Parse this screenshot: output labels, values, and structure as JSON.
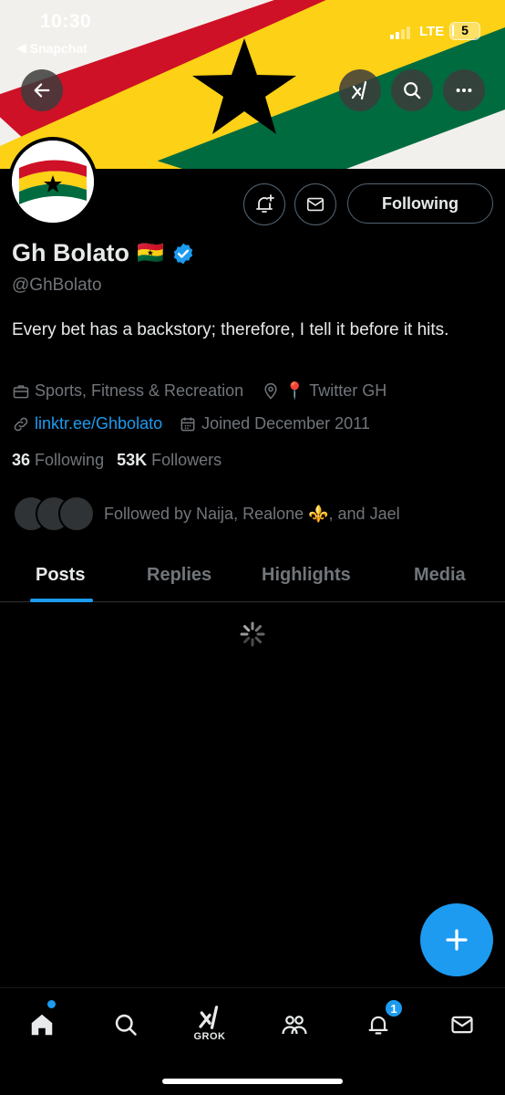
{
  "status_bar": {
    "time": "10:30",
    "back_app": "Snapchat",
    "network": "LTE",
    "battery": "5",
    "battery_level": 0.05
  },
  "profile": {
    "name": "Gh Bolato",
    "name_flag": "🇬🇭",
    "handle": "@GhBolato",
    "bio": "Every bet has a backstory; therefore, I tell it before it hits.",
    "category": "Sports, Fitness & Recreation",
    "location": "📍 Twitter GH",
    "link": "linktr.ee/Ghbolato",
    "joined": "Joined December 2011",
    "following_count": "36",
    "following_label": "Following",
    "followers_count": "53K",
    "followers_label": "Followers",
    "followed_by": "Followed by Naija, Realone ⚜️, and Jael"
  },
  "actions": {
    "following_button": "Following"
  },
  "tabs": [
    {
      "label": "Posts",
      "active": true
    },
    {
      "label": "Replies",
      "active": false
    },
    {
      "label": "Highlights",
      "active": false
    },
    {
      "label": "Media",
      "active": false
    }
  ],
  "bottom_nav": {
    "grok_label": "GROK",
    "notification_badge": "1",
    "icons": [
      "home-icon",
      "search-icon",
      "grok-icon",
      "communities-icon",
      "notifications-icon",
      "messages-icon"
    ]
  },
  "colors": {
    "accent": "#1d9bf0",
    "flag_red": "#ce1126",
    "flag_yellow": "#fcd116",
    "flag_green": "#006b3f"
  }
}
